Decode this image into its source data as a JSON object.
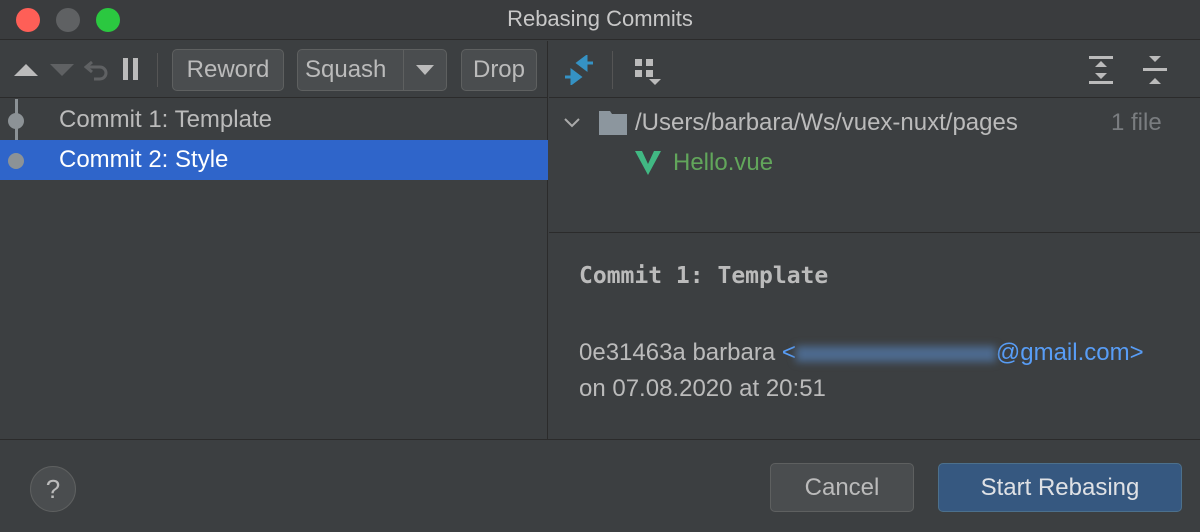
{
  "window": {
    "title": "Rebasing Commits"
  },
  "toolbar": {
    "reword": "Reword",
    "squash": "Squash",
    "drop": "Drop"
  },
  "commits": [
    {
      "label": "Commit 1: Template"
    },
    {
      "label": "Commit 2: Style"
    }
  ],
  "changes": {
    "folder_path": "/Users/barbara/Ws/vuex-nuxt/pages",
    "file_count": "1 file",
    "file": "Hello.vue"
  },
  "details": {
    "title": "Commit 1: Template",
    "hash": "0e31463a",
    "author": "barbara",
    "email_prefix": "<",
    "email_domain": "@gmail.com>",
    "date_line": "on 07.08.2020 at 20:51"
  },
  "footer": {
    "help": "?",
    "cancel": "Cancel",
    "start": "Start Rebasing"
  },
  "colors": {
    "accent": "#2f65ca",
    "link": "#589df6",
    "file_green": "#62a65b",
    "vue": "#41b883"
  }
}
